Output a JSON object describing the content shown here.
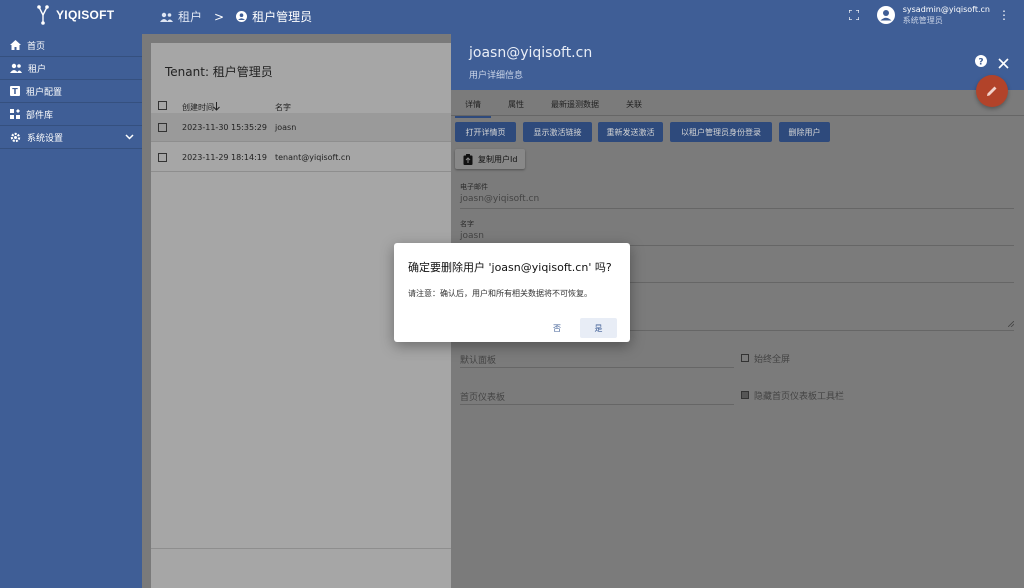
{
  "app": {
    "brand": "YIQISOFT",
    "accent": "#3f5e96"
  },
  "breadcrumb": {
    "parent": "租户",
    "separator": ">",
    "current": "租户管理员"
  },
  "user": {
    "email": "sysadmin@yiqisoft.cn",
    "role": "系统管理员"
  },
  "sidebar": {
    "items": [
      {
        "label": "首页",
        "icon": "home-icon"
      },
      {
        "label": "租户",
        "icon": "tenants-icon"
      },
      {
        "label": "租户配置",
        "icon": "tenant-profile-icon"
      },
      {
        "label": "部件库",
        "icon": "widgets-icon"
      },
      {
        "label": "系统设置",
        "icon": "gear-icon"
      }
    ]
  },
  "table": {
    "title": "Tenant: 租户管理员",
    "columns": {
      "created": "创建时间",
      "name": "名字"
    },
    "rows": [
      {
        "created": "2023-11-30 15:35:29",
        "name": "joasn"
      },
      {
        "created": "2023-11-29 18:14:19",
        "name": "tenant@yiqisoft.cn"
      }
    ]
  },
  "panel": {
    "title": "joasn@yiqisoft.cn",
    "subtitle": "用户详细信息",
    "tabs": [
      "详情",
      "属性",
      "最新遥测数据",
      "关联"
    ],
    "buttons": {
      "open_details": "打开详情页",
      "show_activation": "显示激活链接",
      "resend_activation": "重新发送激活",
      "login_as": "以租户管理员身份登录",
      "delete_user": "删除用户",
      "copy_id": "复制用户Id"
    },
    "fields": {
      "email_label": "电子邮件",
      "email_value": "joasn@yiqisoft.cn",
      "name_label": "名字",
      "name_value": "joasn",
      "default_dashboard": "默认面板",
      "always_fullscreen": "始终全屏",
      "home_dashboard": "首页仪表板",
      "hide_toolbar": "隐藏首页仪表板工具栏"
    }
  },
  "dialog": {
    "title": "确定要删除用户 'joasn@yiqisoft.cn' 吗?",
    "message": "请注意：确认后，用户和所有相关数据将不可恢复。",
    "no": "否",
    "yes": "是"
  }
}
